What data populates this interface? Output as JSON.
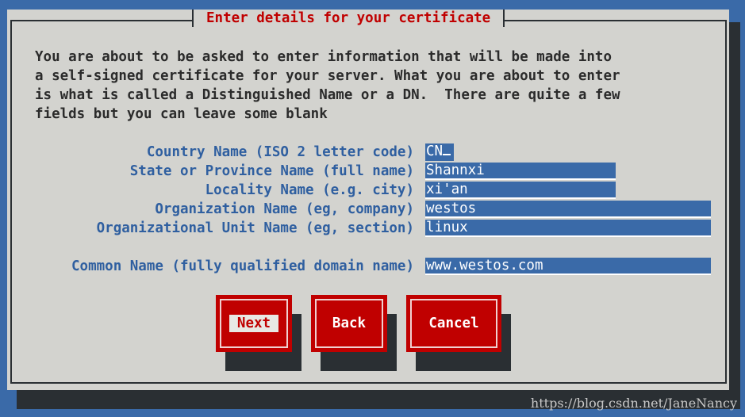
{
  "dialog": {
    "title": "Enter details for your certificate",
    "intro_lines": [
      "You are about to be asked to enter information that will be made into",
      "a self-signed certificate for your server. What you are about to enter",
      "is what is called a Distinguished Name or a DN.  There are quite a few",
      "fields but you can leave some blank"
    ]
  },
  "fields": [
    {
      "label": "Country Name (ISO 2 letter code)",
      "value": "CN"
    },
    {
      "label": "State or Province Name (full name)",
      "value": "Shannxi"
    },
    {
      "label": "Locality Name (e.g. city)",
      "value": "xi'an"
    },
    {
      "label": "Organization Name (eg, company)",
      "value": "westos"
    },
    {
      "label": "Organizational Unit Name (eg, section)",
      "value": "linux"
    },
    {
      "label": "Common Name (fully qualified domain name)",
      "value": "www.westos.com"
    }
  ],
  "buttons": {
    "next": "Next",
    "back": "Back",
    "cancel": "Cancel"
  },
  "watermark": "https://blog.csdn.net/JaneNancy",
  "colors": {
    "background": "#3a6aa8",
    "dialog": "#d3d3cf",
    "title": "#c00000",
    "label": "#2f5fa0",
    "button": "#c00000"
  }
}
